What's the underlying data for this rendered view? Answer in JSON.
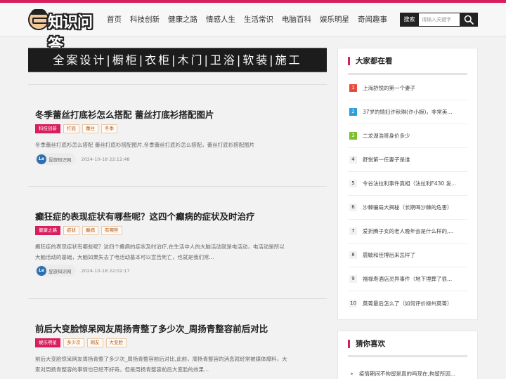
{
  "header": {
    "logo_text": "知识问答",
    "nav": [
      "首页",
      "科技创新",
      "健康之路",
      "情感人生",
      "生活常识",
      "电脑百科",
      "娱乐明星",
      "奇闻趣事"
    ],
    "search_label": "搜索",
    "search_placeholder": "请输入关键字"
  },
  "banner": {
    "text": "全案设计|橱柜|衣柜|木门|卫浴|软装|施工"
  },
  "articles": [
    {
      "title": "冬季蕾丝打底衫怎么搭配 蕾丝打底衫搭配图片",
      "category": "科技创新",
      "tags": [
        "打底",
        "蕾丝",
        "冬季"
      ],
      "summary": "冬季蕾丝打底衫怎么搭配 蕾丝打底衫搭配图片,冬季蕾丝打底衫怎么搭配，蕾丝打底衫搭配图片",
      "author": "昱旅知识网",
      "time": "2024-10-18 22:12:48"
    },
    {
      "title": "癫狂症的表现症状有哪些呢？这四个癫病的症状及时治疗",
      "category": "健康之路",
      "tags": [
        "症状",
        "癫病",
        "有哪些"
      ],
      "summary": "癫狂症的表现症状有哪些呢？这四个癫病的症状及时治疗,在生活中人的大脑活动就是电活动，电活动是所以大脑活动的基础，大脑如果失去了电活动基本可以宣告死亡，也就是我们常...",
      "author": "昱旅知识网",
      "time": "2024-10-18 22:02:17"
    },
    {
      "title": "前后大变脸惊呆网友周扬青整了多少次_周扬青整容前后对比",
      "category": "娱乐明星",
      "tags": [
        "多少次",
        "网友",
        "大变脸"
      ],
      "summary": "前后大变脸惊呆网友周扬青整了多少次_周扬青整容前后对比,此前，周扬青整容的消息就经常被媒体爆料，大家对周扬青整容的事情也已经不好奇。但是周扬青整容前后大变脸的效果..."
    }
  ],
  "hot": {
    "title": "大家都在看",
    "items": [
      {
        "num": "1",
        "text": "上海舒悦的第一个妻子"
      },
      {
        "num": "2",
        "text": "37岁的情妇许秋琳(许小婉)，非常美..."
      },
      {
        "num": "3",
        "text": "二龙湖浩哥身价多少"
      },
      {
        "num": "4",
        "text": "舒悦第一任妻子是谁"
      },
      {
        "num": "5",
        "text": "令谷法拉利事件真相（法拉利F430 发..."
      },
      {
        "num": "6",
        "text": "沙棘骗局大揭秘（长期喝沙棘的危害）"
      },
      {
        "num": "7",
        "text": "爱折腾子女的老人晚年会是什么样的,..."
      },
      {
        "num": "8",
        "text": "晨敏和佳博后来怎样了"
      },
      {
        "num": "9",
        "text": "福禄寿酒店灵异事件（地下埋葬了很..."
      },
      {
        "num": "10",
        "text": "莫菁最后怎么了（如何评价柳州莫菁）"
      }
    ]
  },
  "guess": {
    "title": "猜你喜欢",
    "items": [
      {
        "text": "疫情期间不拘留是真的吗现在,拘留所因..."
      }
    ]
  },
  "colors": {
    "accent": "#d81e5b",
    "rank1": "#e74c3c",
    "rank2": "#2e9fd8",
    "rank3": "#7cbf2d",
    "rank_other": "#f2f2f2"
  }
}
